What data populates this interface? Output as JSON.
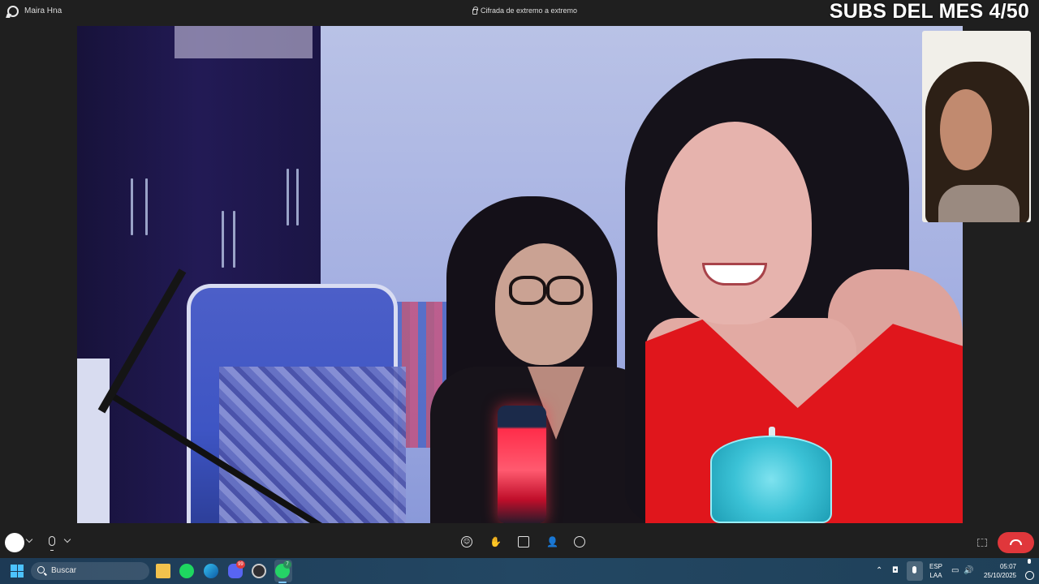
{
  "titlebar": {
    "contact_name": "Maira Hna",
    "encryption_label": "Cifrada de extremo a extremo"
  },
  "overlay": {
    "text": "SUBS DEL MES 4/50"
  },
  "call_controls": {
    "icons": [
      "camera-toggle",
      "chevron-down-icon",
      "microphone-icon",
      "chevron-down-icon",
      "emoji-icon",
      "raise-hand-icon",
      "share-screen-icon",
      "add-participant-icon",
      "chat-icon",
      "layout-icon",
      "end-call-icon"
    ],
    "end_call_color": "#e0373b"
  },
  "taskbar": {
    "search_placeholder": "Buscar",
    "apps": [
      "file-explorer",
      "spotify",
      "edge",
      "discord",
      "obs",
      "whatsapp"
    ],
    "discord_badge": "99",
    "whatsapp_badge": "7",
    "language": "ESP",
    "layout": "LAA",
    "time": "05:07",
    "date": "25/10/2025",
    "accent": "#4cc2ff"
  }
}
